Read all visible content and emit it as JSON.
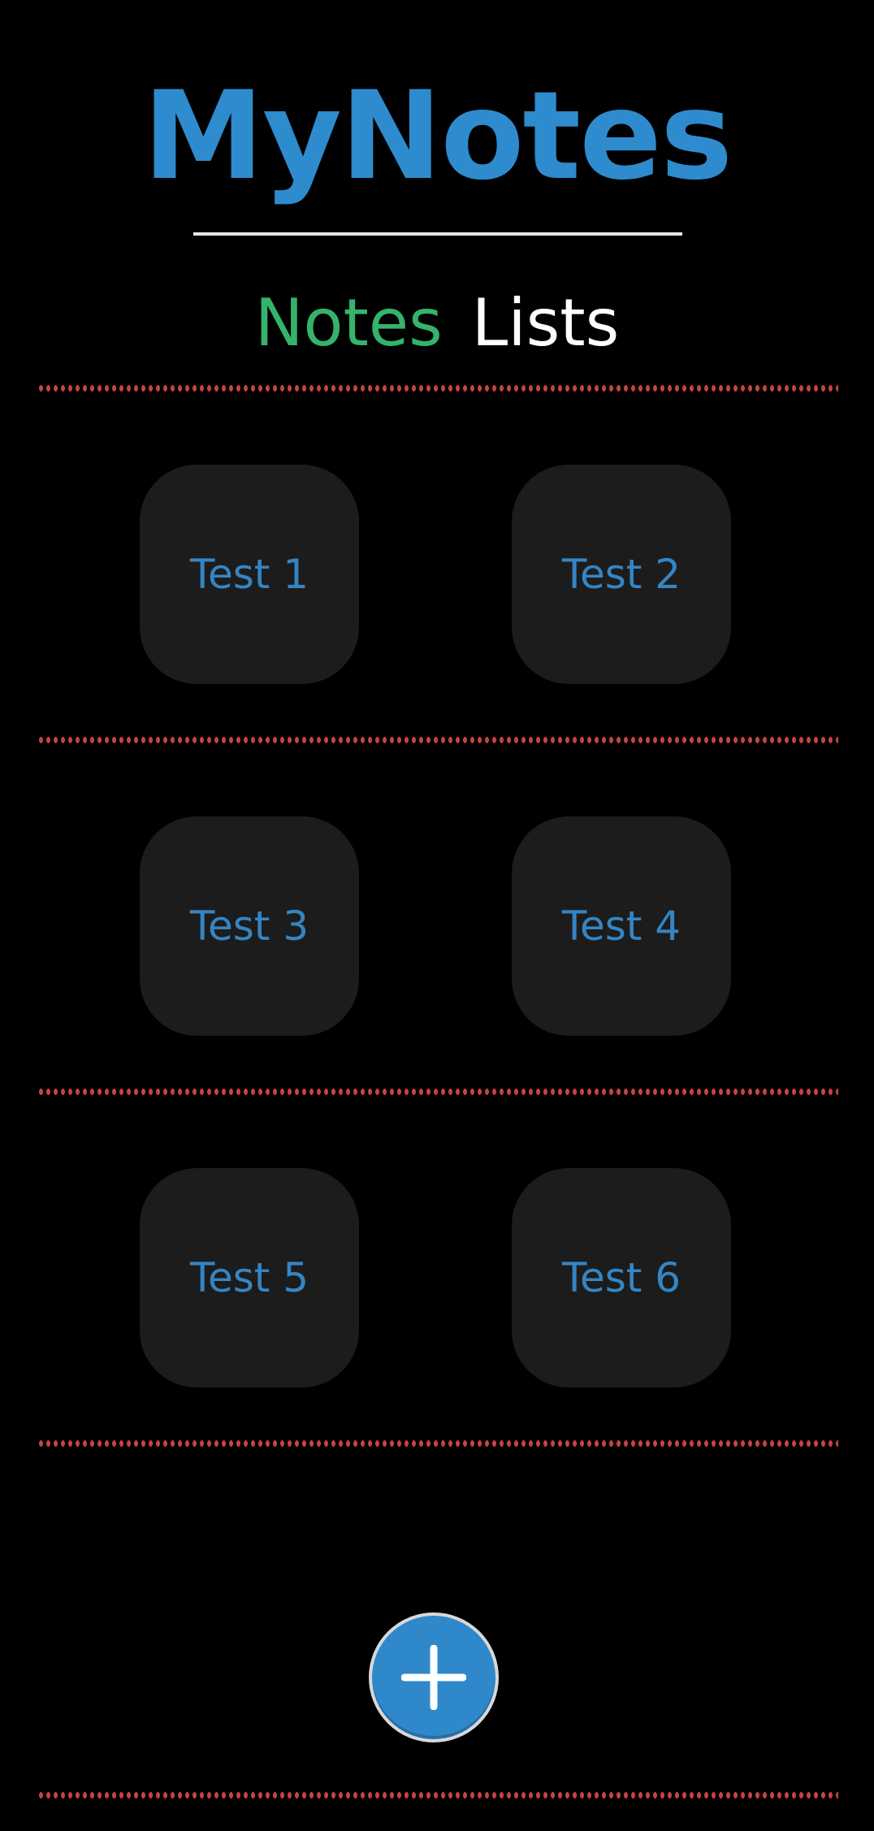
{
  "app": {
    "title": "MyNotes"
  },
  "tabs": [
    {
      "label": "Notes",
      "active": true,
      "color": "#35b26b"
    },
    {
      "label": "Lists",
      "active": false,
      "color": "#ffffff"
    }
  ],
  "notes": [
    {
      "title": "Test 1"
    },
    {
      "title": "Test 2"
    },
    {
      "title": "Test 3"
    },
    {
      "title": "Test 4"
    },
    {
      "title": "Test 5"
    },
    {
      "title": "Test 6"
    }
  ],
  "fab": {
    "icon": "plus-icon"
  },
  "colors": {
    "background": "#000000",
    "title": "#2e8bcd",
    "note_tile": "#1c1c1c",
    "note_text": "#3585c3",
    "divider": "#c7443c",
    "fab": "#2f88c9"
  }
}
